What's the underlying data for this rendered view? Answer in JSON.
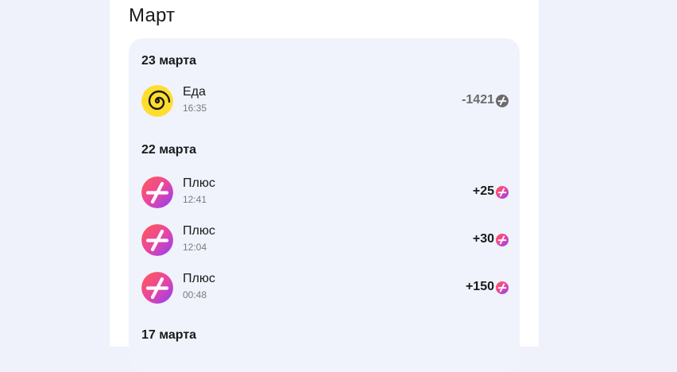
{
  "month": "Март",
  "groups": [
    {
      "date": "23 марта",
      "items": [
        {
          "name": "Еда",
          "time": "16:35",
          "amount": "-1421",
          "kind": "food",
          "icon": "spiral-icon"
        }
      ]
    },
    {
      "date": "22 марта",
      "items": [
        {
          "name": "Плюс",
          "time": "12:41",
          "amount": "+25",
          "kind": "plus",
          "icon": "plus-icon"
        },
        {
          "name": "Плюс",
          "time": "12:04",
          "amount": "+30",
          "kind": "plus",
          "icon": "plus-icon"
        },
        {
          "name": "Плюс",
          "time": "00:48",
          "amount": "+150",
          "kind": "plus",
          "icon": "plus-icon"
        }
      ]
    },
    {
      "date": "17 марта",
      "items": []
    }
  ],
  "colors": {
    "food_bg": "#ffdd2d",
    "plus_gradient_start": "#ff5c4d",
    "plus_gradient_end": "#8a3ffc",
    "negative_coin": "#6b6b6b",
    "card_bg": "#f0f3fc"
  }
}
